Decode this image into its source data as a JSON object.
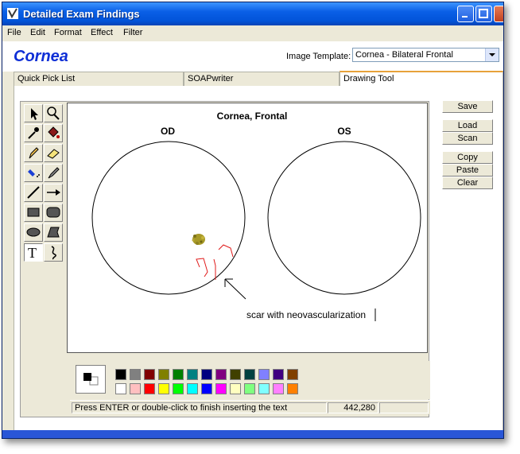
{
  "window": {
    "title": "Detailed Exam Findings"
  },
  "menu": [
    "File",
    "Edit",
    "Format",
    "Effect",
    "Filter"
  ],
  "header": {
    "page_title": "Cornea",
    "template_label": "Image Template:",
    "template_value": "Cornea - Bilateral Frontal"
  },
  "tabs": [
    "Quick Pick List",
    "SOAPwriter",
    "Drawing Tool"
  ],
  "drawing": {
    "title": "Cornea, Frontal",
    "left_eye_label": "OD",
    "right_eye_label": "OS",
    "annotation": "scar with neovascularization"
  },
  "tools": [
    "pointer-icon",
    "zoom-icon",
    "eyedropper-icon",
    "fill-bucket-icon",
    "pencil-icon",
    "eraser-icon",
    "airbrush-icon",
    "brush-icon",
    "line-icon",
    "arrow-icon",
    "rectangle-icon",
    "rounded-rectangle-icon",
    "ellipse-icon",
    "polygon-icon",
    "text-icon",
    "freehand-curve-icon"
  ],
  "palette": {
    "row1": [
      "#000000",
      "#808080",
      "#800000",
      "#808000",
      "#008000",
      "#008080",
      "#000080",
      "#800080",
      "#404000",
      "#004040",
      "#8080ff",
      "#400080",
      "#804000"
    ],
    "row2": [
      "#ffffff",
      "#ffc0c0",
      "#ff0000",
      "#ffff00",
      "#00ff00",
      "#00ffff",
      "#0000ff",
      "#ff00ff",
      "#ffffc0",
      "#80ff80",
      "#80ffff",
      "#ff80ff",
      "#ff8000"
    ]
  },
  "status": {
    "message": "Press ENTER or double-click to finish inserting the text",
    "coordinates": "442,280"
  },
  "buttons": {
    "save": "Save",
    "load": "Load",
    "scan": "Scan",
    "copy": "Copy",
    "paste": "Paste",
    "clear": "Clear"
  }
}
